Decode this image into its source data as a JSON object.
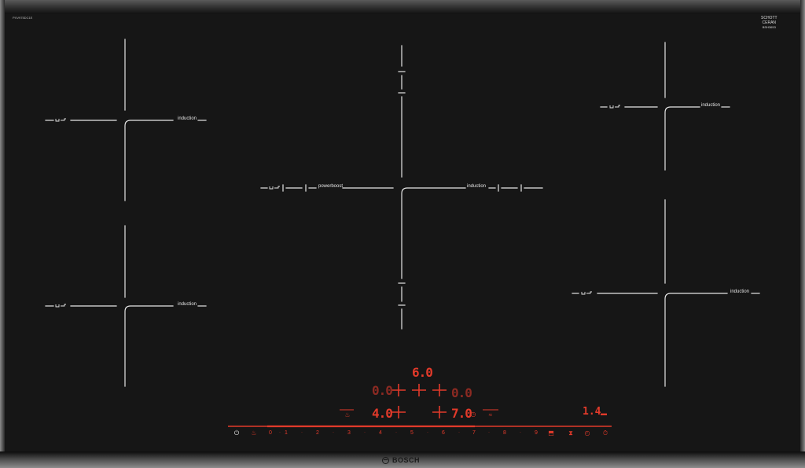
{
  "appliance": {
    "model": "PXV975DC1E",
    "glass_brand_line1": "SCHOTT",
    "glass_brand_line2": "CERAN",
    "glass_brand_line3": "BSH3653",
    "brand": "BOSCH"
  },
  "zones": {
    "left_top": {
      "label": "induction"
    },
    "left_bottom": {
      "label": "induction"
    },
    "center_power": {
      "label": "powerboost"
    },
    "center": {
      "label": "induction"
    },
    "right_top": {
      "label": "induction"
    },
    "right_bottom": {
      "label": "induction"
    }
  },
  "display": {
    "top_value": "6.0",
    "left_pair": "0.0",
    "right_pair": "0.0",
    "left_bottom_value": "4.0",
    "right_bottom_value": "7.0",
    "timer_value": "1.4"
  },
  "slider": {
    "numbers": [
      "0",
      "1",
      "2",
      "3",
      "4",
      "5",
      "6",
      "7",
      "8",
      "9"
    ]
  },
  "icons": {
    "power": "power-icon",
    "flex": "flexinduction-icon",
    "fry": "frying-sensor-icon",
    "fry_right": "frying-sensor-icon",
    "timer": "timer-icon",
    "stopwatch": "stopwatch-icon",
    "lock": "childlock-icon"
  },
  "colors": {
    "glass": "#161616",
    "lines": "#e6e6e6",
    "display_red": "#e23a2a"
  }
}
